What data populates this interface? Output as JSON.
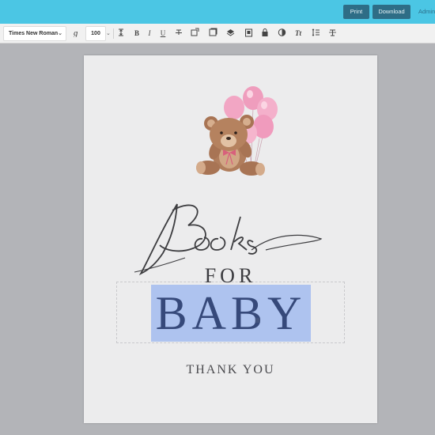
{
  "topbar": {
    "print_label": "Print",
    "download_label": "Download",
    "admin_label": "Admin"
  },
  "toolbar": {
    "font_family": "Times New Roman",
    "font_size": "100",
    "icons": [
      "effects-icon",
      "line-height-icon",
      "bold-icon",
      "italic-icon",
      "underline-icon",
      "strikethrough-icon",
      "image-icon",
      "duplicate-icon",
      "layers-icon",
      "paste-icon",
      "lock-icon",
      "color-icon",
      "text-case-icon",
      "spacing-icon",
      "clear-format-icon"
    ]
  },
  "document": {
    "script_title": "Books",
    "for": "FOR",
    "baby": "BABY",
    "thanks": "THANK YOU"
  },
  "colors": {
    "topbar": "#4bc6e4",
    "button": "#2e6d86",
    "selection_highlight": "#aec3ef",
    "baby_text": "#36497a",
    "balloon": "#f2a6c4"
  }
}
